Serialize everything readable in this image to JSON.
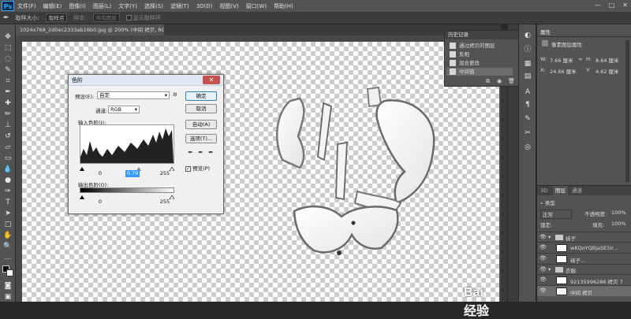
{
  "app": {
    "logo": "Ps"
  },
  "menubar": {
    "items": [
      "文件(F)",
      "编辑(E)",
      "图像(I)",
      "图层(L)",
      "文字(Y)",
      "选择(S)",
      "滤镜(T)",
      "3D(D)",
      "视图(V)",
      "窗口(W)",
      "帮助(H)"
    ],
    "window_controls": [
      "—",
      "□",
      "✕"
    ]
  },
  "options_bar": {
    "sample_size_label": "取样大小:",
    "sample_size_value": "取样点",
    "sample_label": "样本:",
    "sample_value": "所有图层",
    "show_ring_label": "显示取样环"
  },
  "document": {
    "tab_title": "1024x768_2d0ec2333ab16b0.jpg @ 200% (中间 拷贝, RGB/8#/CMYK) *",
    "tab_close": "×"
  },
  "levels_dialog": {
    "title": "色阶",
    "close": "✕",
    "preset_label": "预设(E):",
    "preset_value": "自定",
    "preset_menu_icon": "⚙",
    "channel_label": "通道:",
    "channel_value": "RGB",
    "input_levels_label": "输入色阶(I):",
    "input_black": "0",
    "input_gamma": "0.79",
    "input_white": "255",
    "output_levels_label": "输出色阶(O):",
    "output_black": "0",
    "output_white": "255",
    "buttons": {
      "ok": "确定",
      "cancel": "取消",
      "auto": "自动(A)",
      "options": "选项(T)..."
    },
    "preview_label": "预览(P)",
    "preview_checked": true
  },
  "history_panel": {
    "title": "历史记录",
    "items": [
      {
        "label": "通过拷贝的图层",
        "selected": false
      },
      {
        "label": "反相",
        "selected": false
      },
      {
        "label": "混合更改",
        "selected": false
      },
      {
        "label": "中间值",
        "selected": true
      }
    ]
  },
  "properties_panel": {
    "tab": "属性",
    "subtitle": "像素图层属性",
    "w_label": "W:",
    "w_value": "7.66 厘米",
    "h_label": "H:",
    "h_value": "8.64 厘米",
    "x_label": "X:",
    "x_value": "24.66 厘米",
    "y_label": "Y:",
    "y_value": "4.62 厘米",
    "link_icon": "∞"
  },
  "layers_panel": {
    "tabs": [
      "3D",
      "图层",
      "通道"
    ],
    "active_tab": "图层",
    "filter_label": "类型",
    "blend_mode": "正常",
    "opacity_label": "不透明度:",
    "opacity_value": "100%",
    "lock_label": "锁定:",
    "fill_label": "填充:",
    "fill_value": "100%",
    "rows": [
      {
        "type": "folder",
        "name": "袜子",
        "indent": 0
      },
      {
        "type": "layer",
        "name": "wKQoYQBjaSE5Ir...",
        "indent": 1
      },
      {
        "type": "layer",
        "name": "袜子...",
        "indent": 1
      },
      {
        "type": "folder",
        "name": "衣服",
        "indent": 0
      },
      {
        "type": "layer",
        "name": "92135996286 拷贝 7",
        "indent": 1
      },
      {
        "type": "layer",
        "name": "中间 拷贝",
        "indent": 1
      }
    ]
  },
  "watermark": {
    "text": "Bai 经验"
  }
}
